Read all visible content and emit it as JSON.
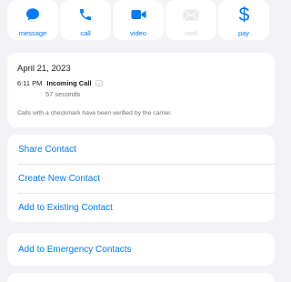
{
  "actions": [
    {
      "label": "message",
      "icon": "message-icon",
      "enabled": true
    },
    {
      "label": "call",
      "icon": "phone-icon",
      "enabled": true
    },
    {
      "label": "video",
      "icon": "video-icon",
      "enabled": true
    },
    {
      "label": "mail",
      "icon": "mail-icon",
      "enabled": false
    },
    {
      "label": "pay",
      "icon": "dollar-icon",
      "enabled": true
    }
  ],
  "call_info": {
    "date": "April 21, 2023",
    "time": "6:11 PM",
    "type": "Incoming Call",
    "duration": "57 seconds",
    "note": "Calls with a checkmark have been verified by the carrier."
  },
  "menu": {
    "share": "Share Contact",
    "create": "Create New Contact",
    "add_existing": "Add to Existing Contact",
    "add_emergency": "Add to Emergency Contacts"
  },
  "colors": {
    "accent": "#007aff",
    "background": "#f2f2f7",
    "disabled": "#d5d5da"
  }
}
